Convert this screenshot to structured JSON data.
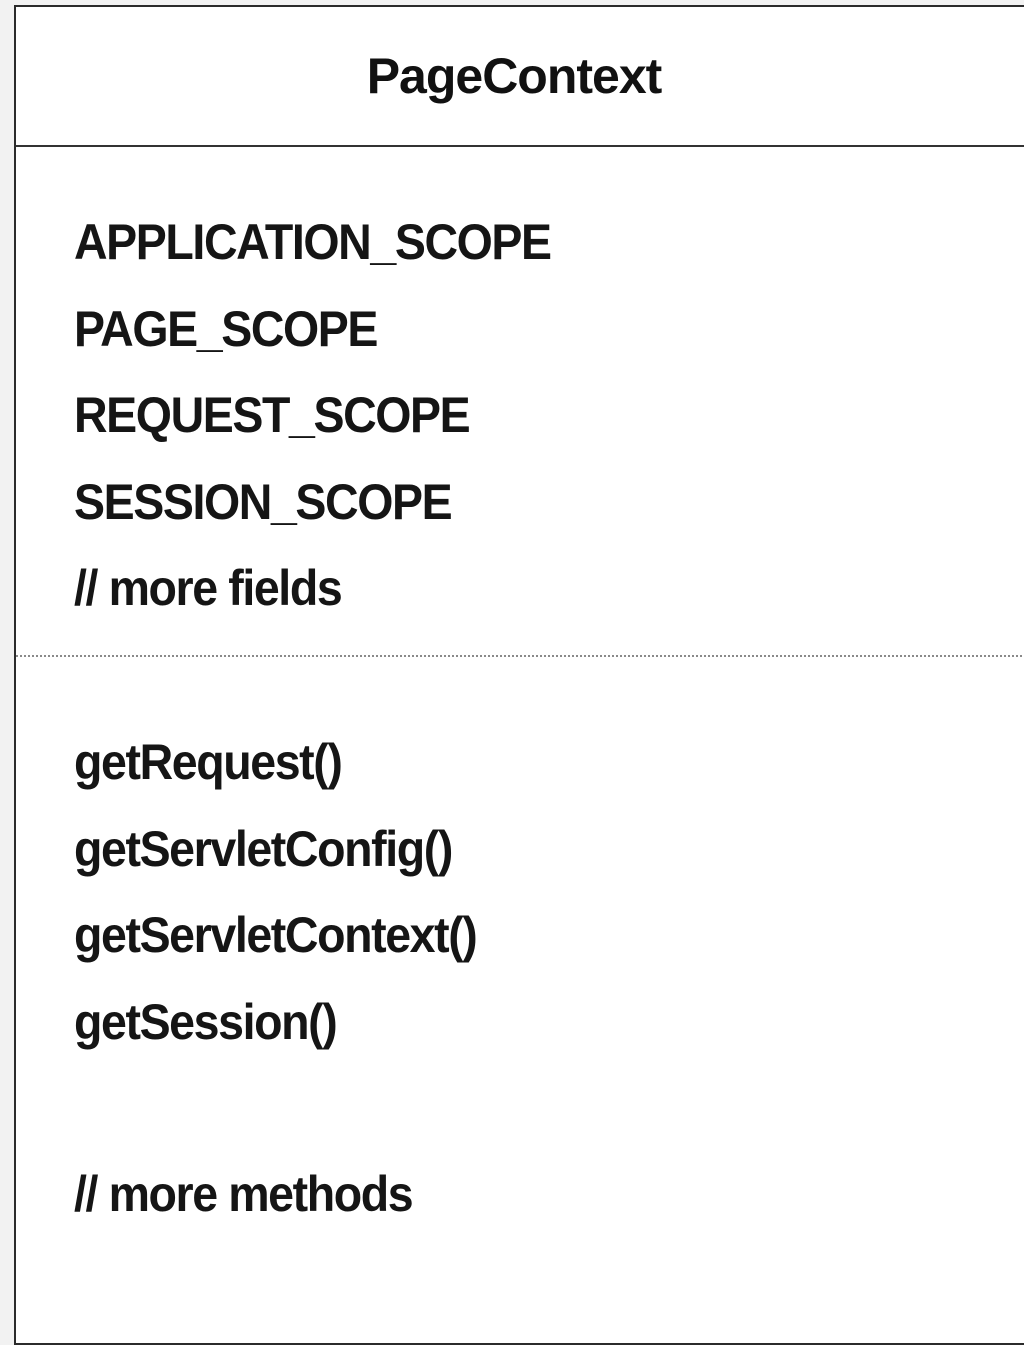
{
  "class": {
    "name": "PageContext",
    "fields": [
      "APPLICATION_SCOPE",
      "PAGE_SCOPE",
      "REQUEST_SCOPE",
      "SESSION_SCOPE",
      "// more fields"
    ],
    "methods": [
      "getRequest()",
      "getServletConfig()",
      "getServletContext()",
      "getSession()"
    ],
    "methods_footer": "// more methods"
  }
}
